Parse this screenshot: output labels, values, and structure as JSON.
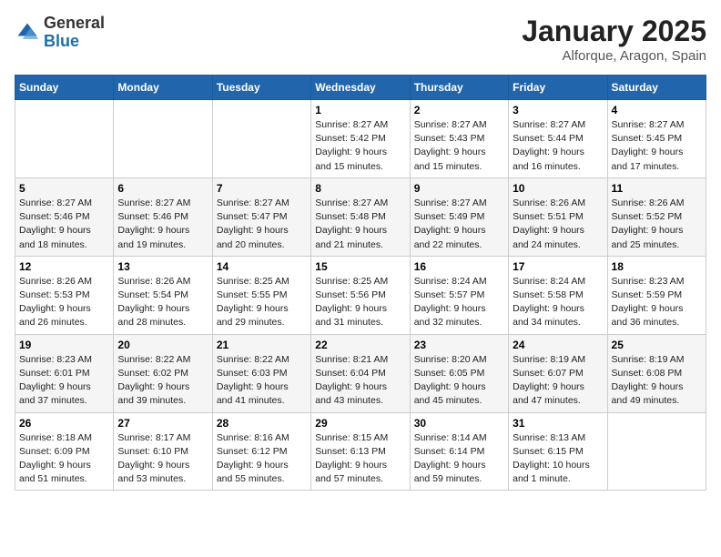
{
  "header": {
    "logo_line1": "General",
    "logo_line2": "Blue",
    "month": "January 2025",
    "location": "Alforque, Aragon, Spain"
  },
  "weekdays": [
    "Sunday",
    "Monday",
    "Tuesday",
    "Wednesday",
    "Thursday",
    "Friday",
    "Saturday"
  ],
  "weeks": [
    [
      {
        "day": "",
        "content": ""
      },
      {
        "day": "",
        "content": ""
      },
      {
        "day": "",
        "content": ""
      },
      {
        "day": "1",
        "content": "Sunrise: 8:27 AM\nSunset: 5:42 PM\nDaylight: 9 hours\nand 15 minutes."
      },
      {
        "day": "2",
        "content": "Sunrise: 8:27 AM\nSunset: 5:43 PM\nDaylight: 9 hours\nand 15 minutes."
      },
      {
        "day": "3",
        "content": "Sunrise: 8:27 AM\nSunset: 5:44 PM\nDaylight: 9 hours\nand 16 minutes."
      },
      {
        "day": "4",
        "content": "Sunrise: 8:27 AM\nSunset: 5:45 PM\nDaylight: 9 hours\nand 17 minutes."
      }
    ],
    [
      {
        "day": "5",
        "content": "Sunrise: 8:27 AM\nSunset: 5:46 PM\nDaylight: 9 hours\nand 18 minutes."
      },
      {
        "day": "6",
        "content": "Sunrise: 8:27 AM\nSunset: 5:46 PM\nDaylight: 9 hours\nand 19 minutes."
      },
      {
        "day": "7",
        "content": "Sunrise: 8:27 AM\nSunset: 5:47 PM\nDaylight: 9 hours\nand 20 minutes."
      },
      {
        "day": "8",
        "content": "Sunrise: 8:27 AM\nSunset: 5:48 PM\nDaylight: 9 hours\nand 21 minutes."
      },
      {
        "day": "9",
        "content": "Sunrise: 8:27 AM\nSunset: 5:49 PM\nDaylight: 9 hours\nand 22 minutes."
      },
      {
        "day": "10",
        "content": "Sunrise: 8:26 AM\nSunset: 5:51 PM\nDaylight: 9 hours\nand 24 minutes."
      },
      {
        "day": "11",
        "content": "Sunrise: 8:26 AM\nSunset: 5:52 PM\nDaylight: 9 hours\nand 25 minutes."
      }
    ],
    [
      {
        "day": "12",
        "content": "Sunrise: 8:26 AM\nSunset: 5:53 PM\nDaylight: 9 hours\nand 26 minutes."
      },
      {
        "day": "13",
        "content": "Sunrise: 8:26 AM\nSunset: 5:54 PM\nDaylight: 9 hours\nand 28 minutes."
      },
      {
        "day": "14",
        "content": "Sunrise: 8:25 AM\nSunset: 5:55 PM\nDaylight: 9 hours\nand 29 minutes."
      },
      {
        "day": "15",
        "content": "Sunrise: 8:25 AM\nSunset: 5:56 PM\nDaylight: 9 hours\nand 31 minutes."
      },
      {
        "day": "16",
        "content": "Sunrise: 8:24 AM\nSunset: 5:57 PM\nDaylight: 9 hours\nand 32 minutes."
      },
      {
        "day": "17",
        "content": "Sunrise: 8:24 AM\nSunset: 5:58 PM\nDaylight: 9 hours\nand 34 minutes."
      },
      {
        "day": "18",
        "content": "Sunrise: 8:23 AM\nSunset: 5:59 PM\nDaylight: 9 hours\nand 36 minutes."
      }
    ],
    [
      {
        "day": "19",
        "content": "Sunrise: 8:23 AM\nSunset: 6:01 PM\nDaylight: 9 hours\nand 37 minutes."
      },
      {
        "day": "20",
        "content": "Sunrise: 8:22 AM\nSunset: 6:02 PM\nDaylight: 9 hours\nand 39 minutes."
      },
      {
        "day": "21",
        "content": "Sunrise: 8:22 AM\nSunset: 6:03 PM\nDaylight: 9 hours\nand 41 minutes."
      },
      {
        "day": "22",
        "content": "Sunrise: 8:21 AM\nSunset: 6:04 PM\nDaylight: 9 hours\nand 43 minutes."
      },
      {
        "day": "23",
        "content": "Sunrise: 8:20 AM\nSunset: 6:05 PM\nDaylight: 9 hours\nand 45 minutes."
      },
      {
        "day": "24",
        "content": "Sunrise: 8:19 AM\nSunset: 6:07 PM\nDaylight: 9 hours\nand 47 minutes."
      },
      {
        "day": "25",
        "content": "Sunrise: 8:19 AM\nSunset: 6:08 PM\nDaylight: 9 hours\nand 49 minutes."
      }
    ],
    [
      {
        "day": "26",
        "content": "Sunrise: 8:18 AM\nSunset: 6:09 PM\nDaylight: 9 hours\nand 51 minutes."
      },
      {
        "day": "27",
        "content": "Sunrise: 8:17 AM\nSunset: 6:10 PM\nDaylight: 9 hours\nand 53 minutes."
      },
      {
        "day": "28",
        "content": "Sunrise: 8:16 AM\nSunset: 6:12 PM\nDaylight: 9 hours\nand 55 minutes."
      },
      {
        "day": "29",
        "content": "Sunrise: 8:15 AM\nSunset: 6:13 PM\nDaylight: 9 hours\nand 57 minutes."
      },
      {
        "day": "30",
        "content": "Sunrise: 8:14 AM\nSunset: 6:14 PM\nDaylight: 9 hours\nand 59 minutes."
      },
      {
        "day": "31",
        "content": "Sunrise: 8:13 AM\nSunset: 6:15 PM\nDaylight: 10 hours\nand 1 minute."
      },
      {
        "day": "",
        "content": ""
      }
    ]
  ]
}
